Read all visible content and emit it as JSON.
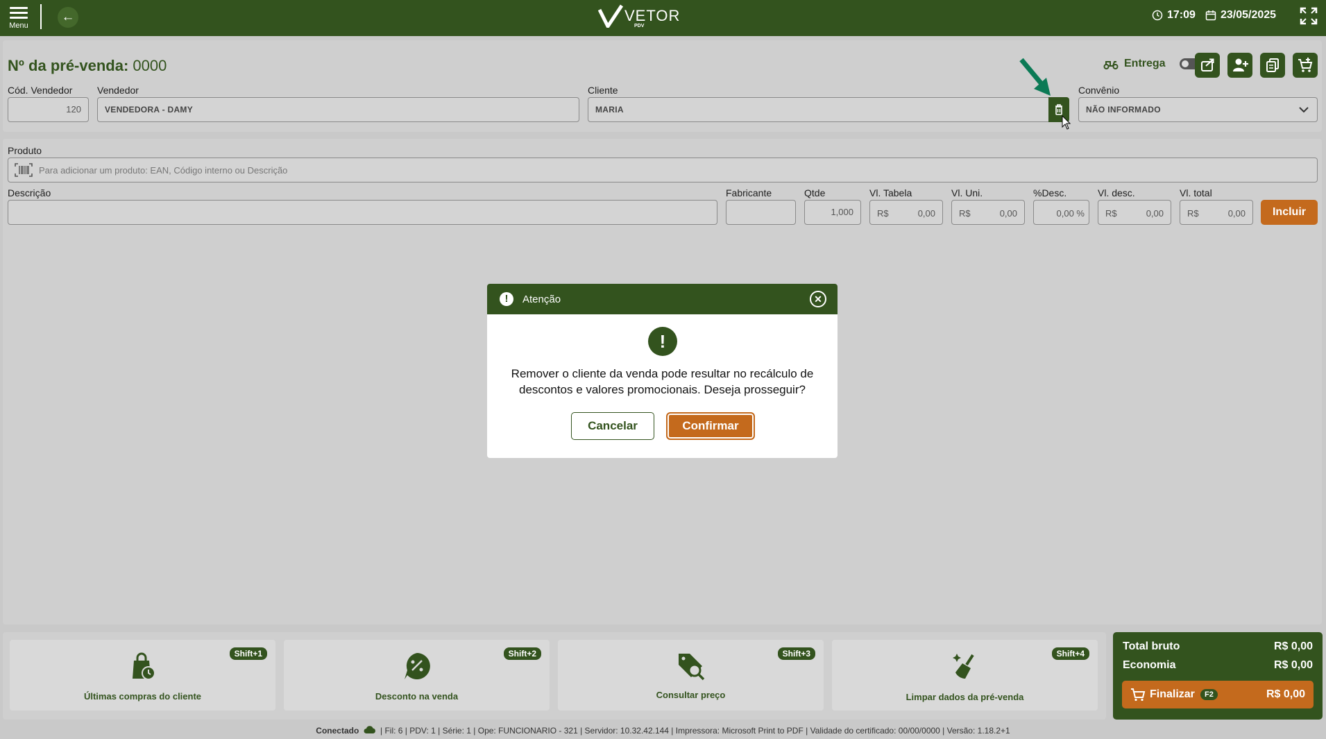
{
  "topbar": {
    "menu_label": "Menu",
    "logo_name": "VETOR",
    "logo_sub": "PDV",
    "time": "17:09",
    "date": "23/05/2025"
  },
  "header": {
    "title_label": "Nº da pré-venda:",
    "title_value": "0000",
    "entrega_label": "Entrega",
    "entrega_enabled": false
  },
  "fields": {
    "cod_vendedor_label": "Cód. Vendedor",
    "cod_vendedor_value": "120",
    "vendedor_label": "Vendedor",
    "vendedor_value": "VENDEDORA - DAMY",
    "cliente_label": "Cliente",
    "cliente_value": "MARIA",
    "convenio_label": "Convênio",
    "convenio_value": "NÃO INFORMADO"
  },
  "produto": {
    "label": "Produto",
    "placeholder": "Para adicionar um produto: EAN, Código interno ou Descrição",
    "descricao_label": "Descrição",
    "fabricante_label": "Fabricante",
    "qtde_label": "Qtde",
    "qtde_value": "1,000",
    "vl_tabela_label": "Vl. Tabela",
    "vl_uni_label": "Vl. Uni.",
    "desc_pct_label": "%Desc.",
    "desc_pct_value": "0,00 %",
    "vl_desc_label": "Vl. desc.",
    "vl_total_label": "Vl. total",
    "currency": "R$",
    "zero": "0,00",
    "incluir_label": "Incluir"
  },
  "modal": {
    "title": "Atenção",
    "message": "Remover o cliente da venda pode resultar no recálculo de descontos e valores promocionais. Deseja prosseguir?",
    "cancel_label": "Cancelar",
    "confirm_label": "Confirmar"
  },
  "actions": [
    {
      "label": "Últimas compras do cliente",
      "shortcut": "Shift+1",
      "icon": "shopping-bag-clock-icon"
    },
    {
      "label": "Desconto na venda",
      "shortcut": "Shift+2",
      "icon": "discount-tag-icon"
    },
    {
      "label": "Consultar preço",
      "shortcut": "Shift+3",
      "icon": "price-search-icon"
    },
    {
      "label": "Limpar dados da pré-venda",
      "shortcut": "Shift+4",
      "icon": "broom-icon"
    }
  ],
  "totals": {
    "bruto_label": "Total bruto",
    "bruto_value": "R$ 0,00",
    "economia_label": "Economia",
    "economia_value": "R$ 0,00",
    "finalizar_label": "Finalizar",
    "finalizar_key": "F2",
    "finalizar_value": "R$ 0,00"
  },
  "status": {
    "connected": "Conectado",
    "details": "| Fil: 6 | PDV: 1 | Série: 1 | Ope: FUNCIONARIO - 321 | Servidor: 10.32.42.144 | Impressora: Microsoft Print to PDF | Validade do certificado: 00/00/0000 | Versão: 1.18.2+1"
  },
  "colors": {
    "primary_green": "#33531e",
    "accent_orange": "#c46a1d",
    "annotation_arrow": "#0b7a55"
  }
}
